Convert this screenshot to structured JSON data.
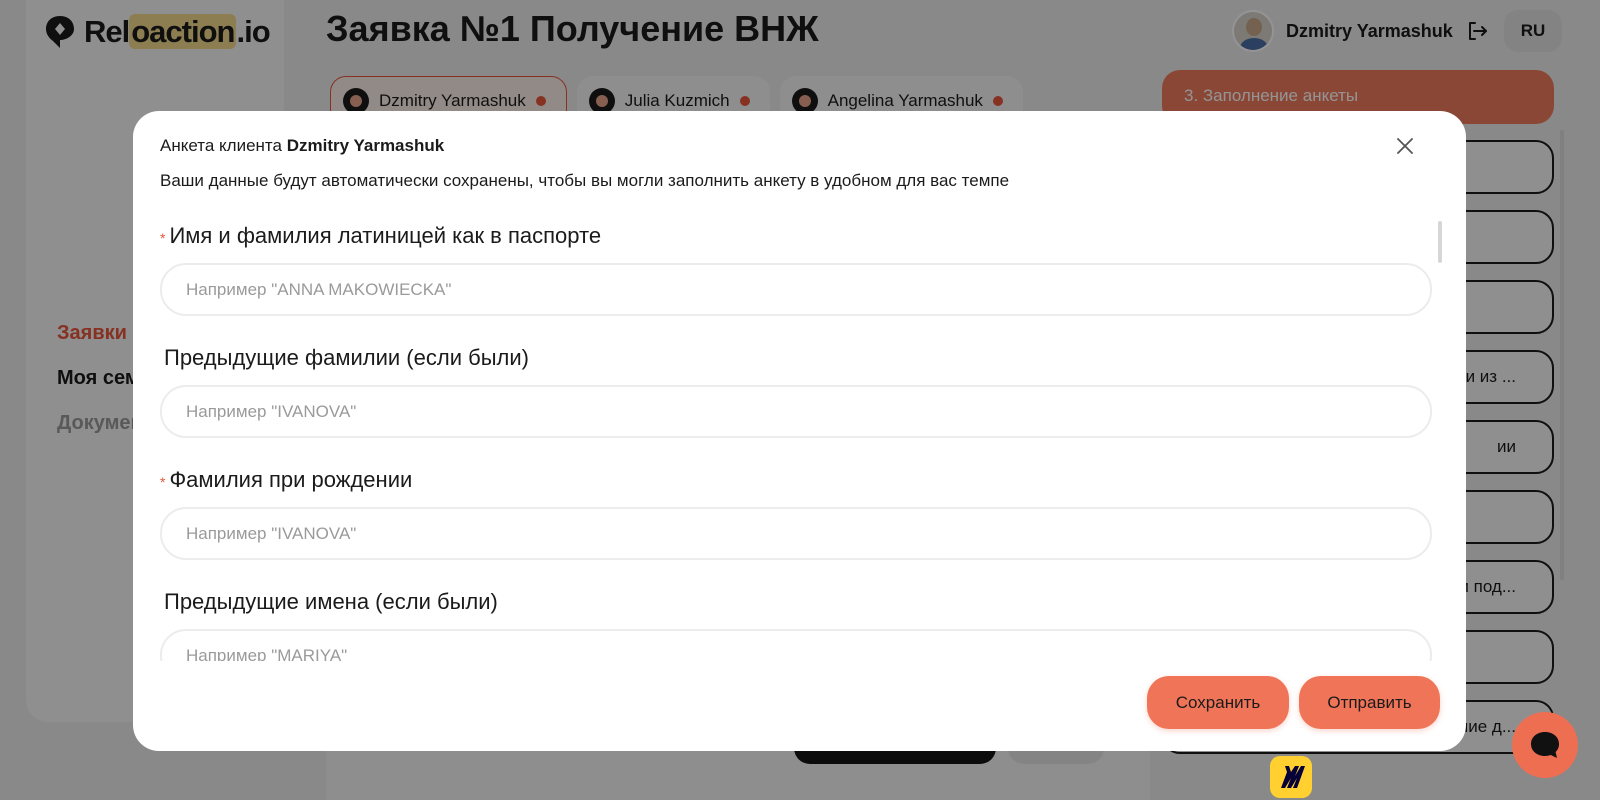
{
  "app": {
    "logo_text_a": "Rel",
    "logo_text_hl": "oaction",
    "logo_text_b": ".io"
  },
  "page": {
    "title": "Заявка №1 Получение ВНЖ"
  },
  "header": {
    "user_name": "Dzmitry Yarmashuk",
    "language": "RU"
  },
  "sidebar": {
    "items": [
      {
        "label": "Заявки"
      },
      {
        "label": "Моя семья"
      },
      {
        "label": "Документы"
      }
    ]
  },
  "client_tabs": [
    {
      "name": "Dzmitry Yarmashuk"
    },
    {
      "name": "Julia Kuzmich"
    },
    {
      "name": "Angelina Yarmashuk"
    }
  ],
  "steps": {
    "current": "3. Заполнение анкеты",
    "items": [
      {
        "label": ""
      },
      {
        "label": ""
      },
      {
        "label": ""
      },
      {
        "label": "сти из ..."
      },
      {
        "label": "ии"
      },
      {
        "label": ""
      },
      {
        "label": "и под..."
      },
      {
        "label": ""
      },
      {
        "label": "ение д..."
      }
    ]
  },
  "modal": {
    "heading_prefix": "Анкета клиента",
    "heading_name": "Dzmitry Yarmashuk",
    "subtitle": "Ваши данные будут автоматически сохранены, чтобы вы могли заполнить анкету в удобном для вас темпе",
    "fields": [
      {
        "label": "Имя и фамилия латиницей как в паспорте",
        "required": "*",
        "placeholder": "Например \"ANNA MAKOWIECKA\"",
        "value": ""
      },
      {
        "label": "Предыдущие фамилии (если были)",
        "required": "",
        "placeholder": "Например \"IVANOVA\"",
        "value": ""
      },
      {
        "label": "Фамилия при рождении",
        "required": "*",
        "placeholder": "Например \"IVANOVA\"",
        "value": ""
      },
      {
        "label": "Предыдущие имена (если были)",
        "required": "",
        "placeholder": "Например \"MARIYA\"",
        "value": ""
      }
    ],
    "save_label": "Сохранить",
    "submit_label": "Отправить"
  },
  "colors": {
    "accent": "#f07558",
    "primary_text": "#1b1b1b",
    "muted": "#9a9a9a",
    "required": "#e8553b"
  }
}
